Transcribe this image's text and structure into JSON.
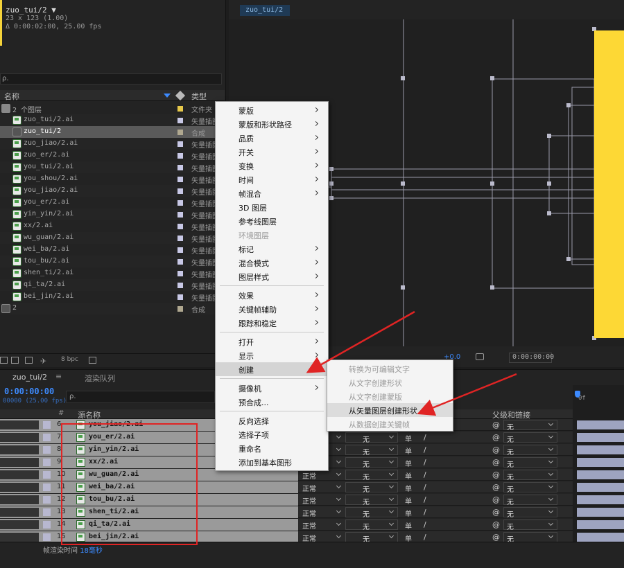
{
  "project": {
    "comp_title": "zuo_tui/2 ▼",
    "comp_size": "23 x 123 (1.00)",
    "comp_duration": "Δ 0:00:02:00, 25.00 fps",
    "search_icon": "ρ.",
    "col_name": "名称",
    "col_type": "类型",
    "items": [
      {
        "name": "2 个图层",
        "type": "文件夹",
        "icon": "folder",
        "swatch": "#e6c84a"
      },
      {
        "name": "zuo_tui/2.ai",
        "type": "矢量插图",
        "icon": "ai",
        "swatch": "#c8c8e6"
      },
      {
        "name": "zuo_tui/2",
        "type": "合成",
        "icon": "comp",
        "swatch": "#b0a890",
        "selected": true
      },
      {
        "name": "zuo_jiao/2.ai",
        "type": "矢量插图",
        "icon": "ai",
        "swatch": "#c8c8e6"
      },
      {
        "name": "zuo_er/2.ai",
        "type": "矢量插图",
        "icon": "ai",
        "swatch": "#c8c8e6"
      },
      {
        "name": "you_tui/2.ai",
        "type": "矢量插图",
        "icon": "ai",
        "swatch": "#c8c8e6"
      },
      {
        "name": "you_shou/2.ai",
        "type": "矢量插图",
        "icon": "ai",
        "swatch": "#c8c8e6"
      },
      {
        "name": "you_jiao/2.ai",
        "type": "矢量插图",
        "icon": "ai",
        "swatch": "#c8c8e6"
      },
      {
        "name": "you_er/2.ai",
        "type": "矢量插图",
        "icon": "ai",
        "swatch": "#c8c8e6"
      },
      {
        "name": "yin_yin/2.ai",
        "type": "矢量插图",
        "icon": "ai",
        "swatch": "#c8c8e6"
      },
      {
        "name": "xx/2.ai",
        "type": "矢量插图",
        "icon": "ai",
        "swatch": "#c8c8e6"
      },
      {
        "name": "wu_guan/2.ai",
        "type": "矢量插图",
        "icon": "ai",
        "swatch": "#c8c8e6"
      },
      {
        "name": "wei_ba/2.ai",
        "type": "矢量插图",
        "icon": "ai",
        "swatch": "#c8c8e6"
      },
      {
        "name": "tou_bu/2.ai",
        "type": "矢量插图",
        "icon": "ai",
        "swatch": "#c8c8e6"
      },
      {
        "name": "shen_ti/2.ai",
        "type": "矢量插图",
        "icon": "ai",
        "swatch": "#c8c8e6"
      },
      {
        "name": "qi_ta/2.ai",
        "type": "矢量插图",
        "icon": "ai",
        "swatch": "#c8c8e6"
      },
      {
        "name": "bei_jin/2.ai",
        "type": "矢量插图",
        "icon": "ai",
        "swatch": "#c8c8e6"
      },
      {
        "name": "2",
        "type": "合成",
        "icon": "comp",
        "swatch": "#b0a890"
      }
    ],
    "bpc": "8 bpc"
  },
  "viewer": {
    "tab": "zuo_tui/2",
    "exposure": "+0.0",
    "timecode": "0:00:00:00",
    "accent_color": "#fdd835"
  },
  "timeline": {
    "tab": "zuo_tui/2",
    "tab_close": "≡",
    "render_queue_tab": "渲染队列",
    "current_time": "0:00:00:00",
    "fps": "00000 (25.00 fps)",
    "search_icon": "ρ.",
    "col_num": "#",
    "col_name": "源名称",
    "col_parent": "父级和链接",
    "layers": [
      {
        "num": "6",
        "name": "you_jiao/2.ai",
        "mode": "",
        "track": "无",
        "parent": "无"
      },
      {
        "num": "7",
        "name": "you_er/2.ai",
        "mode": "",
        "track": "无",
        "parent": "无"
      },
      {
        "num": "8",
        "name": "yin_yin/2.ai",
        "mode": "",
        "track": "无",
        "parent": "无"
      },
      {
        "num": "9",
        "name": "xx/2.ai",
        "mode": "",
        "track": "无",
        "parent": "无"
      },
      {
        "num": "10",
        "name": "wu_guan/2.ai",
        "mode": "正常",
        "track": "无",
        "parent": "无"
      },
      {
        "num": "11",
        "name": "wei_ba/2.ai",
        "mode": "正常",
        "track": "无",
        "parent": "无"
      },
      {
        "num": "12",
        "name": "tou_bu/2.ai",
        "mode": "正常",
        "track": "无",
        "parent": "无"
      },
      {
        "num": "13",
        "name": "shen_ti/2.ai",
        "mode": "正常",
        "track": "无",
        "parent": "无"
      },
      {
        "num": "14",
        "name": "qi_ta/2.ai",
        "mode": "正常",
        "track": "无",
        "parent": "无"
      },
      {
        "num": "15",
        "name": "bei_jin/2.ai",
        "mode": "正常",
        "track": "无",
        "parent": "无"
      }
    ],
    "switch_glyph": "单",
    "ruler_label": "0f",
    "render_time_label": "帧渲染时间",
    "render_time_value": "18毫秒"
  },
  "context_menu": {
    "items": [
      {
        "label": "蒙版",
        "submenu": true
      },
      {
        "label": "蒙版和形状路径",
        "submenu": true
      },
      {
        "label": "品质",
        "submenu": true
      },
      {
        "label": "开关",
        "submenu": true
      },
      {
        "label": "变换",
        "submenu": true
      },
      {
        "label": "时间",
        "submenu": true
      },
      {
        "label": "帧混合",
        "submenu": true
      },
      {
        "label": "3D 图层",
        "submenu": false
      },
      {
        "label": "参考线图层",
        "submenu": false
      },
      {
        "label": "环境图层",
        "submenu": false,
        "disabled": true
      },
      {
        "label": "标记",
        "submenu": true
      },
      {
        "label": "混合模式",
        "submenu": true
      },
      {
        "label": "图层样式",
        "submenu": true
      },
      {
        "sep": true
      },
      {
        "label": "效果",
        "submenu": true
      },
      {
        "label": "关键帧辅助",
        "submenu": true
      },
      {
        "label": "跟踪和稳定",
        "submenu": true
      },
      {
        "sep": true
      },
      {
        "label": "打开",
        "submenu": true
      },
      {
        "label": "显示",
        "submenu": true
      },
      {
        "label": "创建",
        "submenu": true,
        "hover": true
      },
      {
        "sep": true
      },
      {
        "label": "摄像机",
        "submenu": true
      },
      {
        "label": "预合成...",
        "submenu": false
      },
      {
        "sep": true
      },
      {
        "label": "反向选择",
        "submenu": false
      },
      {
        "label": "选择子项",
        "submenu": false
      },
      {
        "label": "重命名",
        "submenu": false
      },
      {
        "label": "添加到基本图形",
        "submenu": false
      }
    ]
  },
  "submenu": {
    "items": [
      {
        "label": "转换为可编辑文字",
        "enabled": false
      },
      {
        "label": "从文字创建形状",
        "enabled": false
      },
      {
        "label": "从文字创建蒙版",
        "enabled": false
      },
      {
        "label": "从矢量图层创建形状",
        "enabled": true,
        "hover": true
      },
      {
        "label": "从数据创建关键帧",
        "enabled": false
      }
    ]
  },
  "colors": {
    "highlight_box": "#e02424",
    "arrow": "#e02424",
    "accent_blue": "#3d8bff"
  }
}
